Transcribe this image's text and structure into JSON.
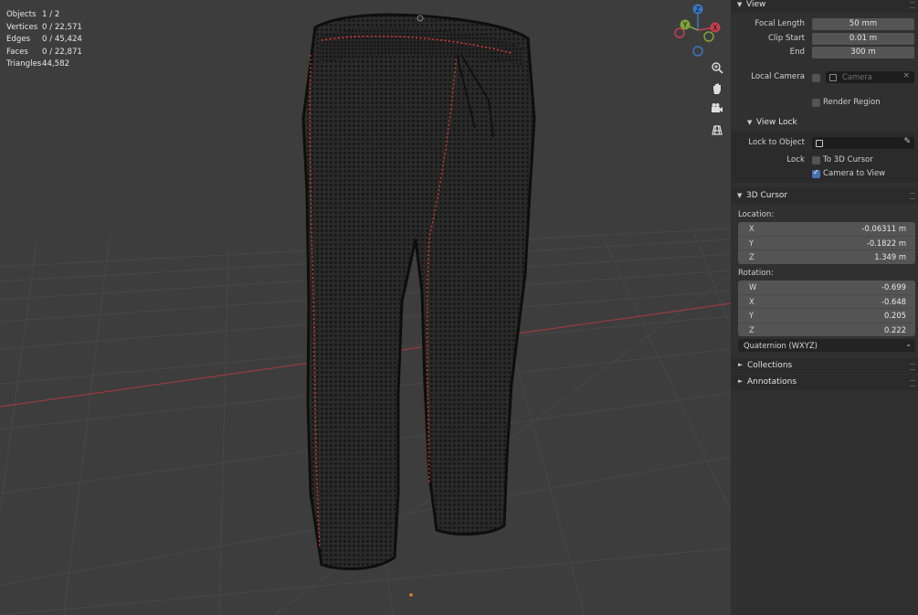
{
  "stats": [
    {
      "label": "Objects",
      "value": "1 / 2"
    },
    {
      "label": "Vertices",
      "value": "0 / 22,571"
    },
    {
      "label": "Edges",
      "value": "0 / 45,424"
    },
    {
      "label": "Faces",
      "value": "0 / 22,871"
    },
    {
      "label": "Triangles",
      "value": "44,582"
    }
  ],
  "gizmo": {
    "x": "X",
    "y": "Y",
    "z": "Z"
  },
  "colors": {
    "x_axis": "#c3404e",
    "y_axis": "#7ea43a",
    "z_axis": "#3a77c3",
    "selection": "#e65a2d"
  },
  "nav_icons": [
    "zoom-icon",
    "hand-pan-icon",
    "camera-icon",
    "grid-icon"
  ],
  "view_panel": {
    "title": "View",
    "focal_length": {
      "label": "Focal Length",
      "value": "50 mm"
    },
    "clip_start": {
      "label": "Clip Start",
      "value": "0.01 m"
    },
    "end": {
      "label": "End",
      "value": "300 m"
    },
    "local_camera": {
      "label": "Local Camera",
      "placeholder": "Camera"
    },
    "render_region": {
      "label": "Render Region"
    }
  },
  "view_lock": {
    "title": "View Lock",
    "lock_to_object": {
      "label": "Lock to Object"
    },
    "lock": {
      "label": "Lock"
    },
    "to_3d_cursor": {
      "label": "To 3D Cursor",
      "checked": false
    },
    "camera_to_view": {
      "label": "Camera to View",
      "checked": true
    }
  },
  "cursor_panel": {
    "title": "3D Cursor",
    "location_label": "Location:",
    "location": [
      {
        "axis": "X",
        "value": "-0.06311 m"
      },
      {
        "axis": "Y",
        "value": "-0.1822 m"
      },
      {
        "axis": "Z",
        "value": "1.349 m"
      }
    ],
    "rotation_label": "Rotation:",
    "rotation": [
      {
        "axis": "W",
        "value": "-0.699"
      },
      {
        "axis": "X",
        "value": "-0.648"
      },
      {
        "axis": "Y",
        "value": "0.205"
      },
      {
        "axis": "Z",
        "value": "0.222"
      }
    ],
    "rotation_mode": "Quaternion (WXYZ)"
  },
  "collections": {
    "title": "Collections"
  },
  "annotations": {
    "title": "Annotations"
  }
}
